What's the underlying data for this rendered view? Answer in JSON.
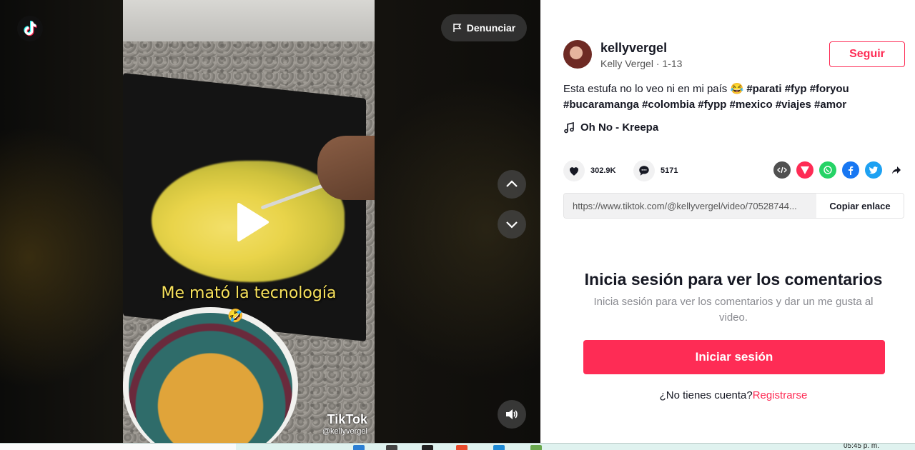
{
  "video": {
    "caption_overlay": "Me mató la tecnología",
    "watermark_brand": "TikTok",
    "watermark_user": "@kellyvergel",
    "report_label": "Denunciar"
  },
  "author": {
    "username": "kellyvergel",
    "display_name": "Kelly Vergel",
    "date": "1-13",
    "follow_label": "Seguir"
  },
  "description": {
    "text": "Esta estufa no lo veo ni en mi país 😂",
    "hashtags": [
      "#parati",
      "#fyp",
      "#foryou",
      "#bucaramanga",
      "#colombia",
      "#fypp",
      "#mexico",
      "#viajes",
      "#amor"
    ]
  },
  "music": {
    "title": "Oh No - Kreepa"
  },
  "stats": {
    "likes": "302.9K",
    "comments": "5171"
  },
  "share": {
    "icons": [
      "embed-icon",
      "send-icon",
      "whatsapp-icon",
      "facebook-icon",
      "twitter-icon",
      "share-arrow-icon"
    ],
    "colors": {
      "embed": "#505050",
      "send": "#fe2c55",
      "whatsapp": "#25d366",
      "facebook": "#1877f2",
      "twitter": "#1da1f2"
    }
  },
  "link": {
    "url": "https://www.tiktok.com/@kellyvergel/video/70528744...",
    "copy_label": "Copiar enlace"
  },
  "login": {
    "title": "Inicia sesión para ver los comentarios",
    "subtitle": "Inicia sesión para ver los comentarios y dar un me gusta al video.",
    "button_label": "Iniciar sesión",
    "no_account": "¿No tienes cuenta?",
    "signup_label": "Registrarse"
  },
  "taskbar": {
    "time": "05:45 p. m."
  },
  "colors": {
    "accent": "#fe2c55",
    "text": "#161823",
    "muted": "#8a8b91"
  }
}
